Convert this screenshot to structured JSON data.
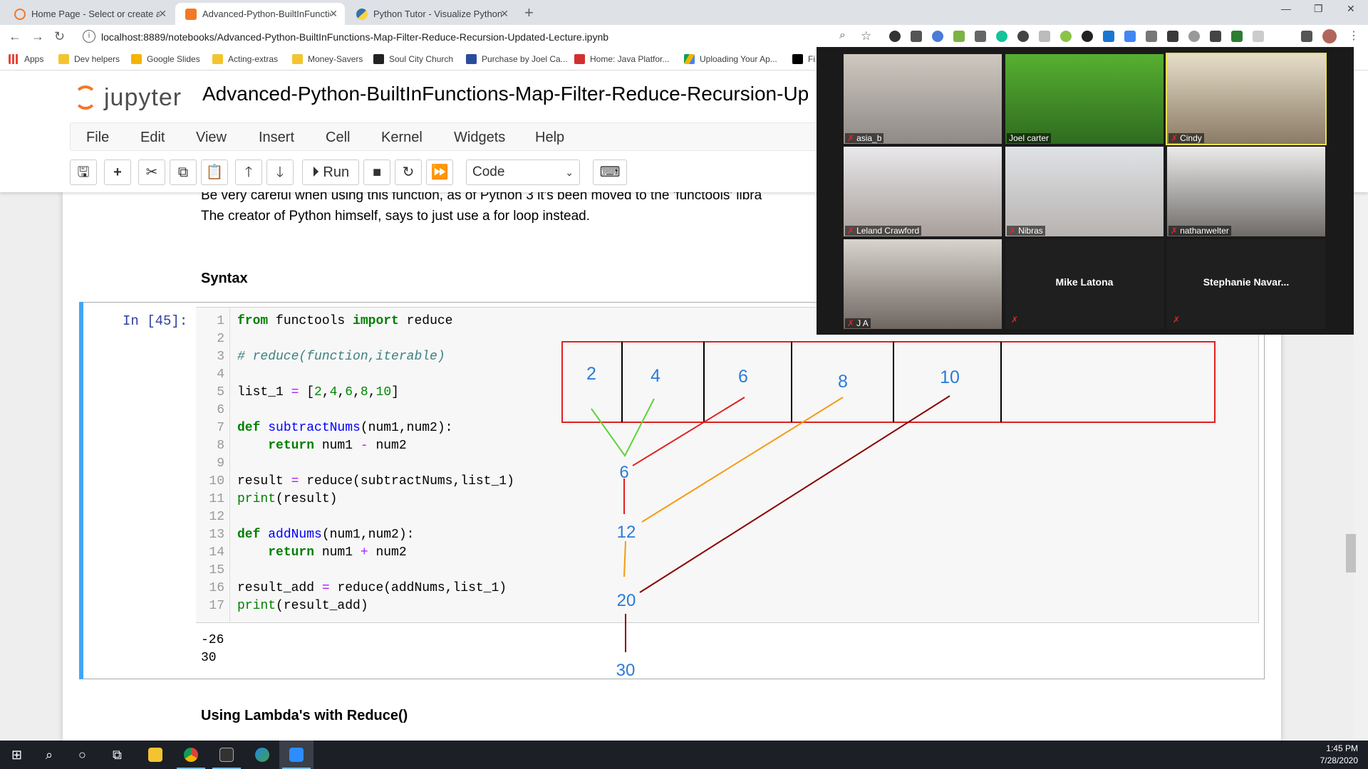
{
  "browser": {
    "tabs": [
      {
        "label": "Home Page - Select or create a n",
        "active": false
      },
      {
        "label": "Advanced-Python-BuiltInFunctio",
        "active": true
      },
      {
        "label": "Python Tutor - Visualize Python,",
        "active": false
      }
    ],
    "url": "localhost:8889/notebooks/Advanced-Python-BuiltInFunctions-Map-Filter-Reduce-Recursion-Updated-Lecture.ipynb",
    "bookmarks": [
      "Apps",
      "Dev helpers",
      "Google Slides",
      "Acting-extras",
      "Money-Savers",
      "Soul City Church",
      "Purchase by Joel Ca...",
      "Home: Java Platfor...",
      "Uploading Your Ap...",
      "Fi"
    ]
  },
  "jupyter": {
    "logo_text": "jupyter",
    "notebook_title": "Advanced-Python-BuiltInFunctions-Map-Filter-Reduce-Recursion-Up",
    "menu": [
      "File",
      "Edit",
      "View",
      "Insert",
      "Cell",
      "Kernel",
      "Widgets",
      "Help"
    ],
    "toolbar": {
      "run_label": "Run",
      "cell_type": "Code"
    }
  },
  "notebook": {
    "md_line1": "Be very careful when using this function, as of Python 3 it's been moved to the 'functools' libra",
    "md_line2": "The creator of Python himself, says to just use a for loop instead.",
    "syntax_heading": "Syntax",
    "prompt": "In [45]:",
    "code_lines": [
      "from functools import reduce",
      "",
      "# reduce(function,iterable)",
      "",
      "list_1 = [2,4,6,8,10]",
      "",
      "def subtractNums(num1,num2):",
      "    return num1 - num2",
      "",
      "result = reduce(subtractNums,list_1)",
      "print(result)",
      "",
      "def addNums(num1,num2):",
      "    return num1 + num2",
      "",
      "result_add = reduce(addNums,list_1)",
      "print(result_add)"
    ],
    "outputs": [
      "-26",
      "30"
    ],
    "lambda_heading": "Using Lambda's with Reduce()"
  },
  "annotation": {
    "list_values": [
      "2",
      "4",
      "6",
      "8",
      "10"
    ],
    "partial_results": [
      "6",
      "12",
      "20",
      "30"
    ],
    "colors": {
      "box": "#e02020",
      "text": "#2b7bd6",
      "green": "#5bd43a",
      "red": "#e02020",
      "orange": "#f39c12",
      "darkred": "#8b0000"
    }
  },
  "zoom": {
    "participants": [
      {
        "name": "asia_b",
        "muted": true,
        "video": true
      },
      {
        "name": "Joel carter",
        "muted": false,
        "video": true
      },
      {
        "name": "Cindy",
        "muted": true,
        "video": true,
        "active_speaker": true
      },
      {
        "name": "Leland Crawford",
        "muted": true,
        "video": true
      },
      {
        "name": "Nibras",
        "muted": true,
        "video": true
      },
      {
        "name": "nathanwelter",
        "muted": true,
        "video": true
      },
      {
        "name": "J A",
        "muted": true,
        "video": true
      },
      {
        "name": "Mike Latona",
        "muted": true,
        "video": false
      },
      {
        "name": "Stephanie  Navar...",
        "muted": true,
        "video": false
      }
    ]
  },
  "taskbar": {
    "time": "1:45 PM",
    "date": "7/28/2020"
  }
}
